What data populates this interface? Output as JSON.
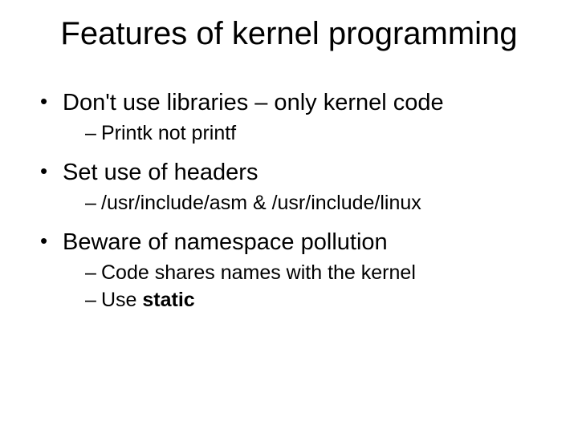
{
  "title": "Features of kernel programming",
  "bullets": {
    "b1": "Don't use libraries – only kernel code",
    "b1s1": "Printk not printf",
    "b2": "Set use of headers",
    "b2s1": "/usr/include/asm & /usr/include/linux",
    "b3": "Beware of namespace pollution",
    "b3s1": "Code shares names with the kernel",
    "b3s2a": "Use ",
    "b3s2b": "static"
  }
}
